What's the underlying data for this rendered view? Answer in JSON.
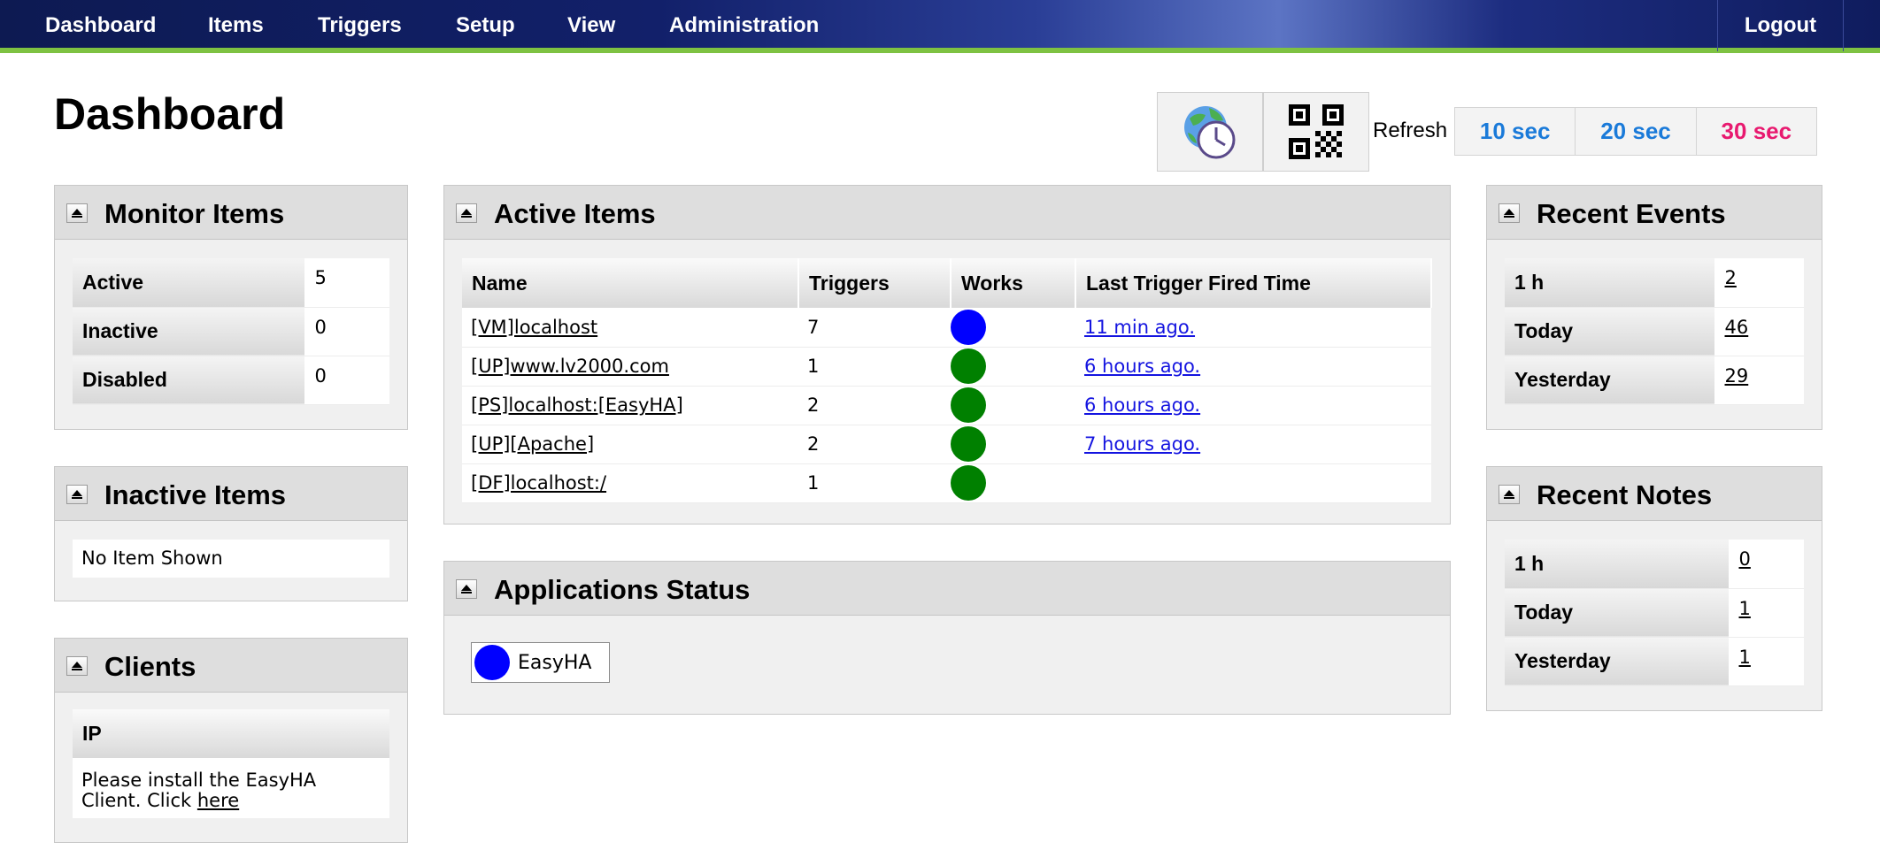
{
  "nav": {
    "items": [
      "Dashboard",
      "Items",
      "Triggers",
      "Setup",
      "View",
      "Administration"
    ],
    "logout": "Logout"
  },
  "page": {
    "title": "Dashboard"
  },
  "toolbar": {
    "icons": [
      "world-clock-icon",
      "qr-code-icon"
    ],
    "refresh_label": "Refresh",
    "refresh_options": [
      "10 sec",
      "20 sec",
      "30 sec"
    ],
    "colors": {
      "refresh_option": "#1a7ad9",
      "refresh_selected": "#e8196f"
    }
  },
  "monitor_items": {
    "title": "Monitor Items",
    "rows": [
      {
        "label": "Active",
        "value": "5"
      },
      {
        "label": "Inactive",
        "value": "0"
      },
      {
        "label": "Disabled",
        "value": "0"
      }
    ]
  },
  "inactive_items": {
    "title": "Inactive Items",
    "empty_text": "No Item Shown"
  },
  "clients": {
    "title": "Clients",
    "column": "IP",
    "message": "Please install the EasyHA Client. Click ",
    "link": "here"
  },
  "active_items": {
    "title": "Active Items",
    "columns": [
      "Name",
      "Triggers",
      "Works",
      "Last Trigger Fired Time"
    ],
    "rows": [
      {
        "name": "[VM]localhost",
        "triggers": "7",
        "status_color": "#0000ff",
        "last_fired": "11 min ago."
      },
      {
        "name": "[UP]www.lv2000.com",
        "triggers": "1",
        "status_color": "#008000",
        "last_fired": "6 hours ago."
      },
      {
        "name": "[PS]localhost:[EasyHA]",
        "triggers": "2",
        "status_color": "#008000",
        "last_fired": "6 hours ago."
      },
      {
        "name": "[UP][Apache]",
        "triggers": "2",
        "status_color": "#008000",
        "last_fired": "7 hours ago."
      },
      {
        "name": "[DF]localhost:/",
        "triggers": "1",
        "status_color": "#008000",
        "last_fired": ""
      }
    ]
  },
  "applications_status": {
    "title": "Applications Status",
    "apps": [
      {
        "name": "EasyHA",
        "status_color": "#0000ff"
      }
    ]
  },
  "recent_events": {
    "title": "Recent Events",
    "rows": [
      {
        "label": "1 h",
        "value": "2"
      },
      {
        "label": "Today",
        "value": "46"
      },
      {
        "label": "Yesterday",
        "value": "29"
      }
    ]
  },
  "recent_notes": {
    "title": "Recent Notes",
    "rows": [
      {
        "label": "1 h",
        "value": "0"
      },
      {
        "label": "Today",
        "value": "1"
      },
      {
        "label": "Yesterday",
        "value": "1"
      }
    ]
  }
}
